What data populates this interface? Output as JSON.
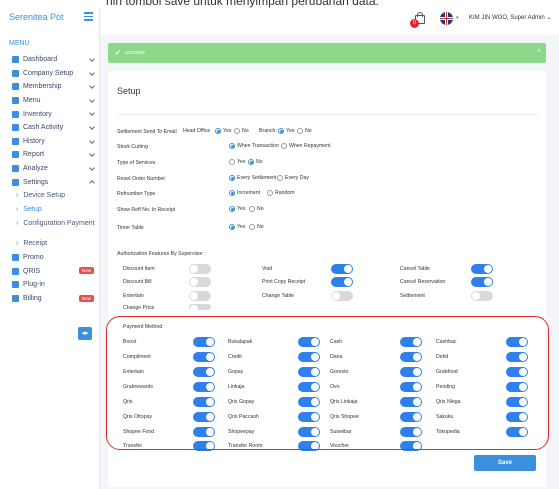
{
  "caption": "nin tombol save untuk menyimpan perubahan data.",
  "brand": "Serenitea Pot",
  "menu_label": "MENU",
  "nav": [
    {
      "label": "Dashboard",
      "icon": "dashboard-icon",
      "chevron": "down"
    },
    {
      "label": "Company Setup",
      "icon": "building-icon",
      "chevron": "down"
    },
    {
      "label": "Membership",
      "icon": "users-icon",
      "chevron": "down"
    },
    {
      "label": "Menu",
      "icon": "utensils-icon",
      "chevron": "down"
    },
    {
      "label": "Inventory",
      "icon": "box-icon",
      "chevron": "down"
    },
    {
      "label": "Cash Activity",
      "icon": "dollar-icon",
      "chevron": "down"
    },
    {
      "label": "History",
      "icon": "history-icon",
      "chevron": "down"
    },
    {
      "label": "Report",
      "icon": "report-icon",
      "chevron": "down"
    },
    {
      "label": "Analyze",
      "icon": "analyze-icon",
      "chevron": "down"
    },
    {
      "label": "Settings",
      "icon": "gear-icon",
      "chevron": "up"
    }
  ],
  "settings_sub": [
    {
      "label": "Device Setup",
      "active": false
    },
    {
      "label": "Setup",
      "active": true
    },
    {
      "label": "Configuration Payment",
      "active": false
    },
    {
      "label": "Receipt",
      "active": false
    }
  ],
  "nav_bottom": [
    {
      "label": "Promo",
      "icon": "percent-icon",
      "badge": ""
    },
    {
      "label": "QRIS",
      "icon": "qr-icon",
      "badge": "New"
    },
    {
      "label": "Plug-in",
      "icon": "plugin-icon",
      "badge": ""
    },
    {
      "label": "Billing",
      "icon": "billing-icon",
      "badge": "New"
    }
  ],
  "topbar": {
    "cart_count": "0",
    "user": "KIM JIN WOO, Super Admin"
  },
  "alert": {
    "icon": "✔",
    "message": "success",
    "close": "×"
  },
  "page_title": "Setup",
  "settings": {
    "settlement_label": "Settlement Send To Email",
    "head_office": "Head Office",
    "branch": "Branch",
    "yes": "Yes",
    "no": "No",
    "stock_cutting_label": "Stock Cutting",
    "when_transaction": "When Transaction",
    "when_repayment": "When Repayment",
    "type_services_label": "Type of Services",
    "reset_order_label": "Reset Order Number",
    "every_settlement": "Every Settlement",
    "every_day": "Every Day",
    "refnumber_label": "Refnumber Type",
    "increment": "Increment",
    "random": "Random",
    "show_reff_label": "Show Reff No. In Receipt",
    "timer_table_label": "Timer Table"
  },
  "auth_title": "Authorization Features By Supervisor :",
  "auth_features": [
    {
      "label": "Discount Item",
      "on": false
    },
    {
      "label": "Void",
      "on": true
    },
    {
      "label": "Cancel Table",
      "on": true
    },
    {
      "label": "Discount Bill",
      "on": false
    },
    {
      "label": "Print Copy Receipt",
      "on": true
    },
    {
      "label": "Cancel Reservation",
      "on": true
    },
    {
      "label": "Entertain",
      "on": false
    },
    {
      "label": "Change Table",
      "on": false
    },
    {
      "label": "Settlement",
      "on": false
    },
    {
      "label": "Change Price",
      "on": false
    }
  ],
  "payment_title": "Payment Method",
  "payment_methods": [
    "Boost",
    "Bukalapak",
    "Cash",
    "Cashbac",
    "Compliment",
    "Credit",
    "Dana",
    "Debit",
    "Entertain",
    "Gopay",
    "Goresto",
    "Grabfood",
    "Grabrewards",
    "Linkaja",
    "Ovo",
    "Pending",
    "Qris",
    "Qris Gopay",
    "Qris Linkaja",
    "Qris Nlega",
    "Qris Ottopay",
    "Qris Paccash",
    "Qris Shopee",
    "Sakuku",
    "Shopee Food",
    "Shopeepay",
    "Suiseibar",
    "Tokopedia",
    "Transfer",
    "Transfer Room",
    "Voucher"
  ],
  "save_label": "Save",
  "colors": {
    "accent": "#3b8fe0",
    "success": "#8ed88c",
    "toggle_on": "#2f80ed",
    "highlight": "#d9302c"
  }
}
